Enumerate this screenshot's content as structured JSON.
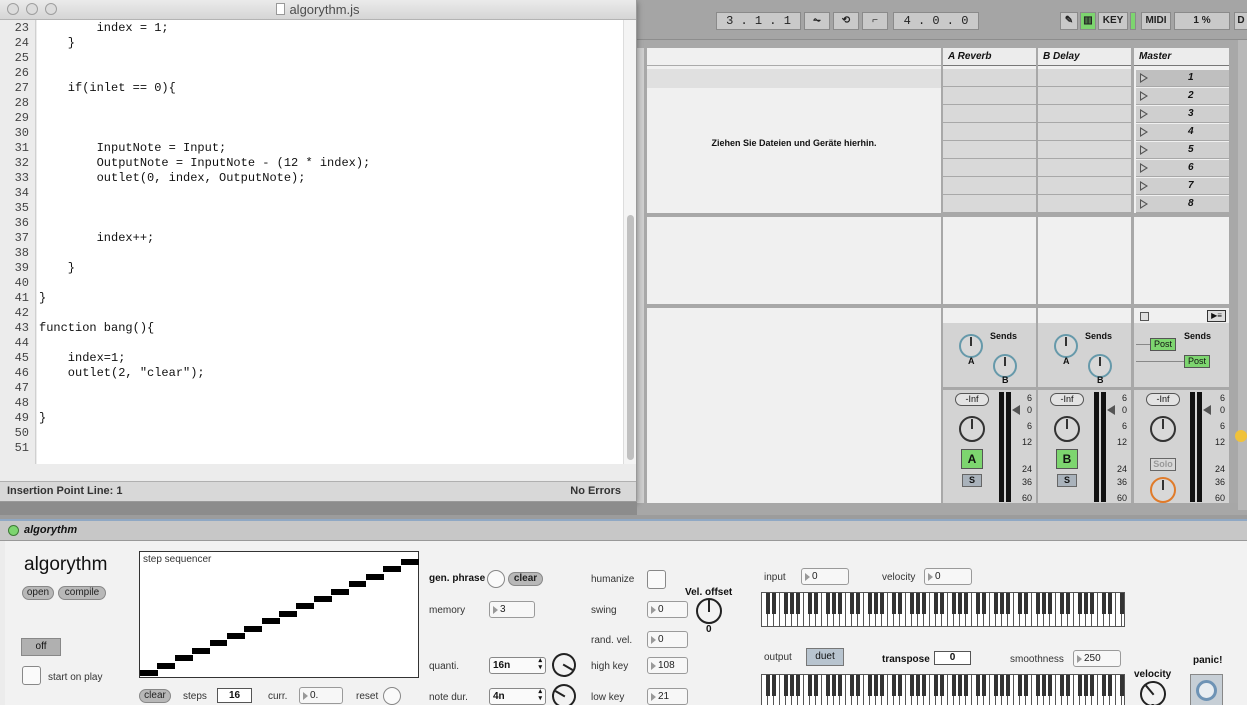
{
  "editor": {
    "title": "algorythm.js",
    "line_numbers": [
      "23",
      "24",
      "25",
      "26",
      "27",
      "28",
      "29",
      "30",
      "31",
      "32",
      "33",
      "34",
      "35",
      "36",
      "37",
      "38",
      "39",
      "40",
      "41",
      "42",
      "43",
      "44",
      "45",
      "46",
      "47",
      "48",
      "49",
      "50",
      "51"
    ],
    "code_lines": [
      "        index = 1;",
      "    }",
      "",
      "",
      "    if(inlet == 0){",
      "",
      "",
      "",
      "        InputNote = Input;",
      "        OutputNote = InputNote - (12 * index);",
      "        outlet(0, index, OutputNote);",
      "",
      "",
      "",
      "        index++;",
      "",
      "    }",
      "",
      "}",
      "",
      "function bang(){",
      "",
      "    index=1;",
      "    outlet(2, \"clear\");",
      "",
      "",
      "}",
      "",
      ""
    ],
    "status_left": "Insertion Point Line: 1",
    "status_right": "No Errors"
  },
  "transport": {
    "position": "3 .   1 .   1",
    "loop_length": "4 .   0 .   0",
    "key_label": "KEY",
    "midi_label": "MIDI",
    "cpu": "1 %",
    "d_label": "D"
  },
  "mixer": {
    "headers": [
      "A Reverb",
      "B Delay",
      "Master"
    ],
    "drop_text": "Ziehen Sie Dateien und Geräte hierhin.",
    "master_slots": [
      "1",
      "2",
      "3",
      "4",
      "5",
      "6",
      "7",
      "8"
    ],
    "sends_label": "Sends",
    "send_a": "A",
    "send_b": "B",
    "post_label": "Post",
    "inf_label": "-Inf",
    "solo_label": "Solo",
    "s_label": "S",
    "track_a": "A",
    "track_b": "B",
    "scale": [
      "6",
      "0",
      "6",
      "12",
      "24",
      "36",
      "60"
    ]
  },
  "device": {
    "name": "algorythm",
    "big_title": "algorythm",
    "open_label": "open",
    "compile_label": "compile",
    "off_label": "off",
    "start_on_play": "start on play",
    "seq_label": "step sequencer",
    "seq_clear": "clear",
    "steps_label": "steps",
    "steps_value": "16",
    "curr_label": "curr.",
    "curr_value": "0.",
    "reset_label": "reset",
    "gen_phrase": "gen. phrase",
    "gen_clear": "clear",
    "memory_label": "memory",
    "memory_value": "3",
    "quanti_label": "quanti.",
    "quanti_value": "16n",
    "note_dur_label": "note dur.",
    "note_dur_value": "4n",
    "humanize_label": "humanize",
    "swing_label": "swing",
    "swing_value": "0",
    "rand_vel_label": "rand. vel.",
    "rand_vel_value": "0",
    "high_key_label": "high key",
    "high_key_value": "108",
    "low_key_label": "low key",
    "low_key_value": "21",
    "vel_offset_label": "Vel. offset",
    "vel_offset_value": "0",
    "input_label": "input",
    "input_value": "0",
    "velocity_label": "velocity",
    "velocity_value": "0",
    "output_label": "output",
    "duet_label": "duet",
    "transpose_label": "transpose",
    "transpose_value": "0",
    "smoothness_label": "smoothness",
    "smoothness_value": "250",
    "velocity_knob_label": "velocity",
    "velocity_knob_value": "0",
    "panic_label": "panic!"
  },
  "sequencer_steps": [
    0,
    1,
    2,
    3,
    4,
    5,
    6,
    7,
    8,
    9,
    10,
    11,
    12,
    13,
    14,
    15
  ]
}
